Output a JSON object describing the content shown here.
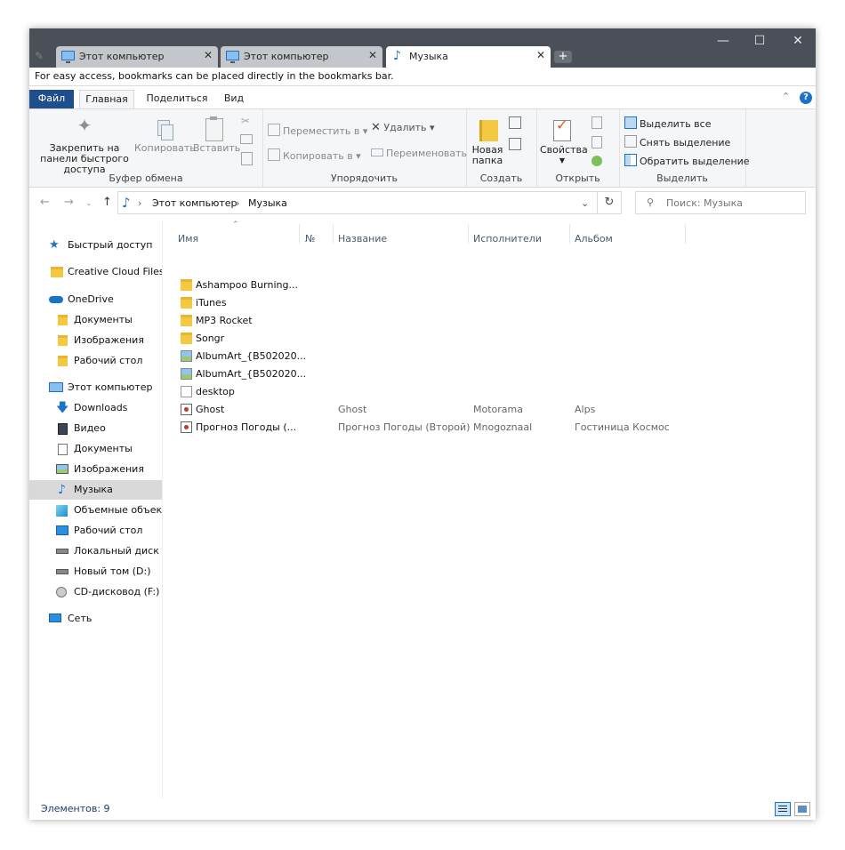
{
  "tabs": [
    {
      "label": "Этот компьютер",
      "close": "✕"
    },
    {
      "label": "Этот компьютер",
      "close": "✕"
    },
    {
      "label": "Музыка",
      "close": "✕"
    }
  ],
  "new_tab": "+",
  "window_controls": {
    "minimize": "—",
    "maximize": "☐",
    "close": "✕"
  },
  "bookmark_hint": "For easy access, bookmarks can be placed directly in the bookmarks bar.",
  "ribbon_tabs": {
    "file": "Файл",
    "home": "Главная",
    "share": "Поделиться",
    "view": "Вид"
  },
  "ribbon": {
    "clipboard": {
      "pin": "Закрепить на панели быстрого доступа",
      "copy": "Копировать",
      "paste": "Вставить",
      "label": "Буфер обмена"
    },
    "organize": {
      "move_to": "Переместить в",
      "copy_to": "Копировать в",
      "delete": "Удалить",
      "rename": "Переименовать",
      "label": "Упорядочить"
    },
    "new": {
      "new_folder": "Новая папка",
      "label": "Создать"
    },
    "open": {
      "properties": "Свойства",
      "label": "Открыть"
    },
    "select": {
      "select_all": "Выделить все",
      "select_none": "Снять выделение",
      "invert": "Обратить выделение",
      "label": "Выделить"
    }
  },
  "address": {
    "segments": [
      "Этот компьютер",
      "Музыка"
    ]
  },
  "search": {
    "placeholder": "Поиск: Музыка"
  },
  "nav": [
    {
      "label": "Быстрый доступ",
      "icon": "star-icon"
    },
    {
      "label": "Creative Cloud Files",
      "icon": "folder-icon"
    },
    {
      "label": "OneDrive",
      "icon": "cloud-icon"
    },
    {
      "label": "Документы",
      "icon": "folder-icon"
    },
    {
      "label": "Изображения",
      "icon": "folder-icon"
    },
    {
      "label": "Рабочий стол",
      "icon": "folder-icon"
    },
    {
      "label": "Этот компьютер",
      "icon": "computer-icon"
    },
    {
      "label": "Downloads",
      "icon": "download-icon"
    },
    {
      "label": "Видео",
      "icon": "video-icon"
    },
    {
      "label": "Документы",
      "icon": "document-icon"
    },
    {
      "label": "Изображения",
      "icon": "pictures-icon"
    },
    {
      "label": "Музыка",
      "icon": "music-icon"
    },
    {
      "label": "Объемные объекты",
      "icon": "3d-objects-icon"
    },
    {
      "label": "Рабочий стол",
      "icon": "desktop-icon"
    },
    {
      "label": "Локальный диск (C:)",
      "icon": "drive-icon"
    },
    {
      "label": "Новый том (D:)",
      "icon": "drive-icon"
    },
    {
      "label": "CD-дисковод (F:)",
      "icon": "cd-drive-icon"
    },
    {
      "label": "Сеть",
      "icon": "network-icon"
    }
  ],
  "columns": {
    "name": "Имя",
    "number": "№",
    "title": "Название",
    "artists": "Исполнители",
    "album": "Альбом"
  },
  "files": [
    {
      "name": "Ashampoo Burning...",
      "type": "folder",
      "title": "",
      "artist": "",
      "album": ""
    },
    {
      "name": "iTunes",
      "type": "folder",
      "title": "",
      "artist": "",
      "album": ""
    },
    {
      "name": "MP3 Rocket",
      "type": "folder",
      "title": "",
      "artist": "",
      "album": ""
    },
    {
      "name": "Songr",
      "type": "folder",
      "title": "",
      "artist": "",
      "album": ""
    },
    {
      "name": "AlbumArt_{B502020...",
      "type": "image",
      "title": "",
      "artist": "",
      "album": ""
    },
    {
      "name": "AlbumArt_{B502020...",
      "type": "image",
      "title": "",
      "artist": "",
      "album": ""
    },
    {
      "name": "desktop",
      "type": "document",
      "title": "",
      "artist": "",
      "album": ""
    },
    {
      "name": "Ghost",
      "type": "audio",
      "title": "Ghost",
      "artist": "Motorama",
      "album": "Alps"
    },
    {
      "name": "Прогноз Погоды (...",
      "type": "audio",
      "title": "Прогноз Погоды (Второй)",
      "artist": "Mnogoznaal",
      "album": "Гостиница Космос"
    }
  ],
  "status": {
    "items_count": "Элементов: 9"
  },
  "colors": {
    "titlebar": "#4a4f58",
    "file_tab": "#1f4e8c",
    "accent": "#0078d7",
    "selected": "#d9d9d9"
  }
}
